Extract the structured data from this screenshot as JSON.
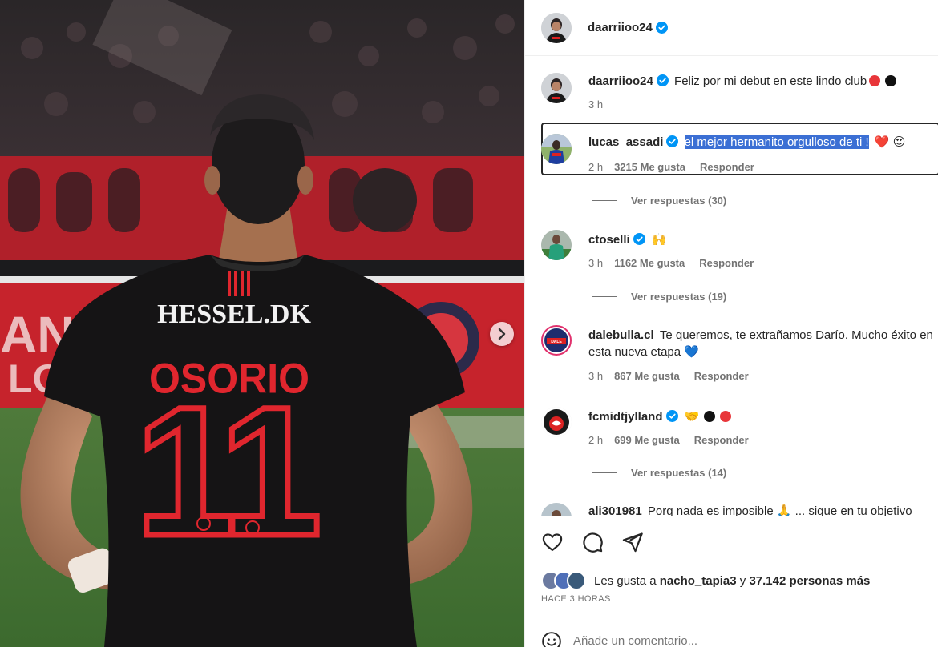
{
  "post": {
    "author": "daarriioo24",
    "jersey": {
      "sponsor": "HESSEL.DK",
      "name": "OSORIO",
      "number": "11"
    }
  },
  "comments": [
    {
      "user": "daarriioo24",
      "verified": true,
      "text": "Feliz por mi debut en este lindo club",
      "emoji": "red-circle black-circle",
      "time": "3 h"
    },
    {
      "user": "lucas_assadi",
      "verified": true,
      "text": "el mejor hermanito orgulloso de ti !",
      "emoji_text": "❤️ 😍",
      "time": "2 h",
      "likes": "3215 Me gusta",
      "reply": "Responder",
      "replies": "Ver respuestas (30)"
    },
    {
      "user": "ctoselli",
      "verified": true,
      "emoji_text": "🙌",
      "time": "3 h",
      "likes": "1162 Me gusta",
      "reply": "Responder",
      "replies": "Ver respuestas (19)"
    },
    {
      "user": "dalebulla.cl",
      "verified": false,
      "text": "Te queremos, te extrañamos Darío. Mucho éxito en",
      "text2": "esta nueva etapa",
      "emoji_text": "💙",
      "time": "3 h",
      "likes": "867 Me gusta",
      "reply": "Responder"
    },
    {
      "user": "fcmidtjylland",
      "verified": true,
      "emoji_text": "🤝",
      "time": "2 h",
      "likes": "699 Me gusta",
      "reply": "Responder",
      "replies": "Ver respuestas (14)"
    },
    {
      "user": "ali301981",
      "text": "Porq nada es imposible 🙏 ... sigue en tu objetivo"
    }
  ],
  "likes": {
    "prefix": "Les gusta a",
    "user": "nacho_tapia3",
    "and": "y",
    "others": "37.142 personas más"
  },
  "timestamp": "HACE 3 HORAS",
  "add_comment_placeholder": "Añade un comentario...",
  "colors": {
    "verified": "#0095f6",
    "selection": "#3b6fd4",
    "jersey_red": "#e0262e"
  }
}
